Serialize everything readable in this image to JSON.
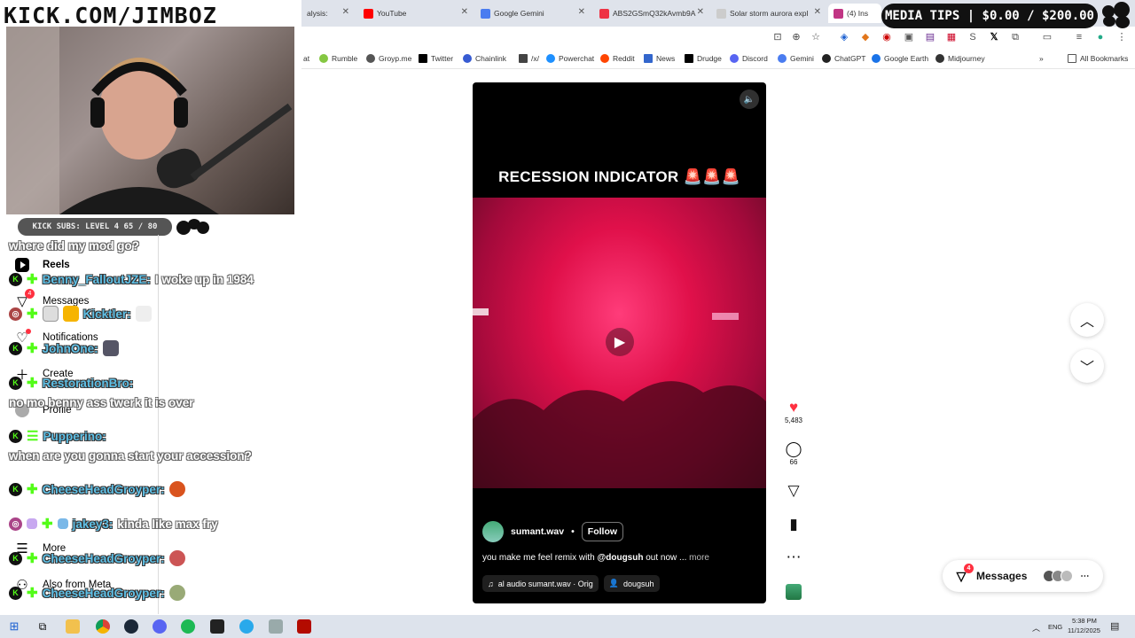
{
  "watermark": "KICK.COM/JIMBOZ",
  "media_tips": "MEDIA TIPS | $0.00 / $200.00",
  "kick_subs": "KICK SUBS: LEVEL 4 65 / 80",
  "browser": {
    "tabs": [
      {
        "label": "alysis:",
        "icon_color": "#777"
      },
      {
        "label": "YouTube",
        "icon_color": "#ff0000"
      },
      {
        "label": "Google Gemini",
        "icon_color": "#4a7cf0"
      },
      {
        "label": "ABS2GSmQ32kAvmb9A",
        "icon_color": "#e34"
      },
      {
        "label": "Solar storm aurora expl",
        "icon_color": "#333"
      },
      {
        "label": "(4) Ins",
        "icon_color": "#c13584"
      }
    ],
    "bookmarks": [
      {
        "label": "at",
        "icon_color": "#999"
      },
      {
        "label": "Rumble",
        "icon_color": "#85c742"
      },
      {
        "label": "Groyp.me",
        "icon_color": "#555"
      },
      {
        "label": "Twitter",
        "icon_color": "#000"
      },
      {
        "label": "Chainlink",
        "icon_color": "#375bd2"
      },
      {
        "label": "/x/",
        "icon_color": "#444"
      },
      {
        "label": "Powerchat",
        "icon_color": "#1e90ff"
      },
      {
        "label": "Reddit",
        "icon_color": "#ff4500"
      },
      {
        "label": "News",
        "icon_color": "#3366cc"
      },
      {
        "label": "Drudge",
        "icon_color": "#000"
      },
      {
        "label": "Discord",
        "icon_color": "#5865f2"
      },
      {
        "label": "Gemini",
        "icon_color": "#4a7cf0"
      },
      {
        "label": "ChatGPT",
        "icon_color": "#222"
      },
      {
        "label": "Google Earth",
        "icon_color": "#1a73e8"
      },
      {
        "label": "Midjourney",
        "icon_color": "#333"
      }
    ],
    "all_bookmarks": "All Bookmarks"
  },
  "instagram_sidebar": {
    "reels": "Reels",
    "messages": "Messages",
    "messages_badge": "4",
    "notifications": "Notifications",
    "create": "Create",
    "profile": "Profile",
    "more": "More",
    "also_from_meta": "Also from Meta"
  },
  "chat": [
    {
      "text": "where did my mod go?"
    },
    {
      "user": "Benny_FalloutJZE:",
      "text": "I woke up in 1984"
    },
    {
      "user": "Kicktler:",
      "text": ""
    },
    {
      "user": "JohnOne:",
      "text": ""
    },
    {
      "user": "RestorationBro:",
      "text": ""
    },
    {
      "text": "no mo benny ass twerk it is over"
    },
    {
      "user": "Pupperino:",
      "text": ""
    },
    {
      "text": "when are you gonna start your accession?"
    },
    {
      "user": "CheeseHeadGroyper:",
      "text": ""
    },
    {
      "user": "jakey3:",
      "text": "kinda like max fry"
    },
    {
      "user": "CheeseHeadGroyper:",
      "text": ""
    },
    {
      "user": "CheeseHeadGroyper:",
      "text": ""
    }
  ],
  "reel": {
    "title": "RECESSION INDICATOR 🚨🚨🚨",
    "author": "sumant.wav",
    "follow": "Follow",
    "caption_prefix": "you make me feel remix with ",
    "caption_mention": "@dougsuh",
    "caption_suffix": " out now ... ",
    "caption_more": "more",
    "audio": "al audio  sumant.wav · Orig",
    "tagged": "dougsuh"
  },
  "actions": {
    "likes": "5,483",
    "comments": "66"
  },
  "messages_float": {
    "label": "Messages",
    "badge": "4"
  },
  "taskbar": {
    "lang": "ENG",
    "time": "5:38 PM",
    "date": "11/12/2025"
  },
  "colors": {
    "kick_green": "#53fc18",
    "like_red": "#ff3040",
    "chat_user": "#5fc0e6"
  }
}
